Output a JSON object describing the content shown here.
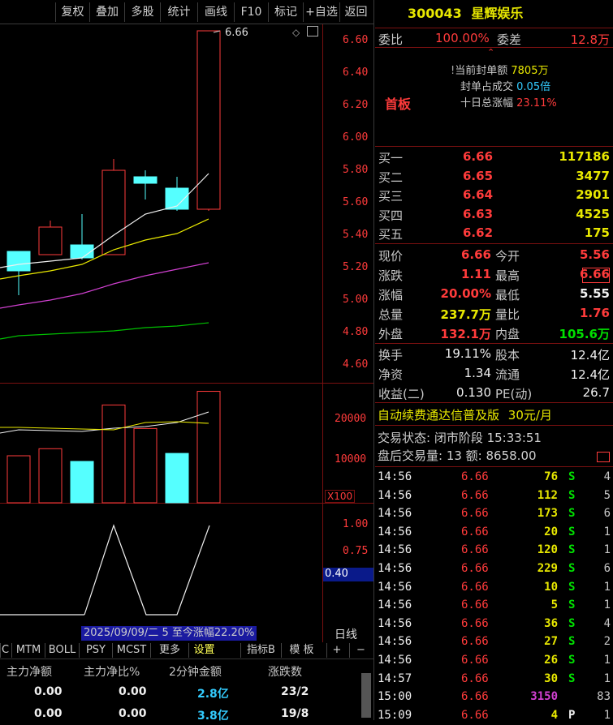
{
  "toolbar": [
    "复权",
    "叠加",
    "多股",
    "统计",
    "画线",
    "F10",
    "标记",
    "+自选",
    "返回"
  ],
  "stock": {
    "code": "300043",
    "name": "星辉娱乐"
  },
  "weibi": {
    "label1": "委比",
    "val1": "100.00%",
    "label2": "委差",
    "val2": "12.8万"
  },
  "limit_box": {
    "badge": "首板",
    "l1": "当前封单额",
    "v1": "7805万",
    "l2": "封单占成交",
    "v2": "0.05倍",
    "l3": "十日总涨幅",
    "v3": "23.11%"
  },
  "bids": [
    {
      "label": "买一",
      "price": "6.66",
      "vol": "117186"
    },
    {
      "label": "买二",
      "price": "6.65",
      "vol": "3477"
    },
    {
      "label": "买三",
      "price": "6.64",
      "vol": "2901"
    },
    {
      "label": "买四",
      "price": "6.63",
      "vol": "4525"
    },
    {
      "label": "买五",
      "price": "6.62",
      "vol": "175"
    }
  ],
  "quote": [
    {
      "l1": "现价",
      "v1": "6.66",
      "l2": "今开",
      "v2": "5.56"
    },
    {
      "l1": "涨跌",
      "v1": "1.11",
      "l2": "最高",
      "v2": "6.66"
    },
    {
      "l1": "涨幅",
      "v1": "20.00%",
      "l2": "最低",
      "v2": "5.55"
    },
    {
      "l1": "总量",
      "v1": "237.7万",
      "l2": "量比",
      "v2": "1.76"
    },
    {
      "l1": "外盘",
      "v1": "132.1万",
      "l2": "内盘",
      "v2": "105.6万"
    }
  ],
  "fund": [
    {
      "l1": "换手",
      "v1": "19.11%",
      "l2": "股本",
      "v2": "12.4亿"
    },
    {
      "l1": "净资",
      "v1": "1.34",
      "l2": "流通",
      "v2": "12.4亿"
    },
    {
      "l1": "收益(二)",
      "v1": "0.130",
      "l2": "PE(动)",
      "v2": "26.7"
    }
  ],
  "promo": {
    "text": "自动续费通达信普及版",
    "price": "30元/月"
  },
  "status": {
    "l1": "交易状态: 闭市阶段 15:33:51",
    "l2": "盘后交易量: 13  额: 8658.00"
  },
  "ticks": [
    {
      "t": "14:56",
      "p": "6.66",
      "v": "76",
      "d": "S",
      "n": "4"
    },
    {
      "t": "14:56",
      "p": "6.66",
      "v": "112",
      "d": "S",
      "n": "5"
    },
    {
      "t": "14:56",
      "p": "6.66",
      "v": "173",
      "d": "S",
      "n": "6"
    },
    {
      "t": "14:56",
      "p": "6.66",
      "v": "20",
      "d": "S",
      "n": "1"
    },
    {
      "t": "14:56",
      "p": "6.66",
      "v": "120",
      "d": "S",
      "n": "1"
    },
    {
      "t": "14:56",
      "p": "6.66",
      "v": "229",
      "d": "S",
      "n": "6"
    },
    {
      "t": "14:56",
      "p": "6.66",
      "v": "10",
      "d": "S",
      "n": "1"
    },
    {
      "t": "14:56",
      "p": "6.66",
      "v": "5",
      "d": "S",
      "n": "1"
    },
    {
      "t": "14:56",
      "p": "6.66",
      "v": "36",
      "d": "S",
      "n": "4"
    },
    {
      "t": "14:56",
      "p": "6.66",
      "v": "27",
      "d": "S",
      "n": "2"
    },
    {
      "t": "14:56",
      "p": "6.66",
      "v": "26",
      "d": "S",
      "n": "1"
    },
    {
      "t": "14:57",
      "p": "6.66",
      "v": "30",
      "d": "S",
      "n": "1"
    },
    {
      "t": "15:00",
      "p": "6.66",
      "v": "3150",
      "d": "",
      "n": "83"
    },
    {
      "t": "15:09",
      "p": "6.66",
      "v": "4",
      "d": "P",
      "n": "1"
    }
  ],
  "price_axis": [
    "6.60",
    "6.40",
    "6.20",
    "6.00",
    "5.80",
    "5.60",
    "5.40",
    "5.20",
    "5.00",
    "4.80",
    "4.60"
  ],
  "high_label": "6.66",
  "vol_axis": [
    "20000",
    "10000"
  ],
  "vol_unit": "X100",
  "ind_axis": [
    "1.00",
    "0.75"
  ],
  "ind_cur": "0.40",
  "period_label": "2025/09/09/二 5 至今涨幅22.20%",
  "period_type": "日线",
  "indicator_tabs": [
    "C",
    "MTM",
    "BOLL",
    "PSY",
    "MCST",
    "更多",
    "设置",
    "指标B",
    "模 板",
    "+",
    "−"
  ],
  "bottom_headers": [
    "主力净额",
    "主力净比%",
    "2分钟金额",
    "涨跌数"
  ],
  "bottom_rows": [
    {
      "a": "0.00",
      "b": "0.00",
      "c": "2.8亿",
      "d": "23/2"
    },
    {
      "a": "0.00",
      "b": "0.00",
      "c": "3.8亿",
      "d": "19/8"
    }
  ],
  "chart_data": {
    "type": "candlestick",
    "candles": [
      {
        "o": 5.3,
        "c": 5.18,
        "h": 5.3,
        "l": 5.03
      },
      {
        "o": 5.28,
        "c": 5.45,
        "h": 5.49,
        "l": 5.28
      },
      {
        "o": 5.34,
        "c": 5.26,
        "h": 5.53,
        "l": 5.25
      },
      {
        "o": 5.28,
        "c": 5.8,
        "h": 5.87,
        "l": 5.28
      },
      {
        "o": 5.76,
        "c": 5.72,
        "h": 5.8,
        "l": 5.62
      },
      {
        "o": 5.69,
        "c": 5.56,
        "h": 5.76,
        "l": 5.55
      },
      {
        "o": 5.56,
        "c": 6.66,
        "h": 6.66,
        "l": 5.55
      }
    ],
    "volumes": [
      10000,
      11500,
      8800,
      20800,
      15800,
      10500,
      23700
    ],
    "volume_up": [
      true,
      true,
      false,
      true,
      true,
      false,
      true
    ],
    "ylim": [
      4.5,
      6.7
    ],
    "vol_ylim": [
      0,
      30000
    ]
  }
}
